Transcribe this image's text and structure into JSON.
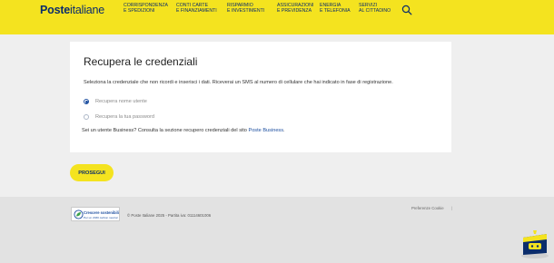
{
  "header": {
    "logo_bold": "Poste",
    "logo_regular": "italiane",
    "nav": [
      {
        "line1": "Corrispondenza",
        "line2": "e spedizioni"
      },
      {
        "line1": "Conti carte",
        "line2": "e finanziamenti"
      },
      {
        "line1": "Risparmio",
        "line2": "e investimenti"
      },
      {
        "line1": "Assicurazioni",
        "line2": "e previdenza"
      },
      {
        "line1": "Energia",
        "line2": "e telefonia"
      },
      {
        "line1": "Servizi",
        "line2": "al cittadino"
      }
    ]
  },
  "form": {
    "title": "Recupera le credenziali",
    "description": "Seleziona la credenziale che non ricordi e inserisci i dati. Riceverai un SMS al numero di cellulare che hai indicato in fase di registrazione.",
    "options": [
      {
        "label": "Recupera nome utente",
        "selected": true
      },
      {
        "label": "Recupera la tua password",
        "selected": false
      }
    ],
    "business_text": "Sei un utente Business? Consulta la sezione recupero credenziali del sito ",
    "business_link": "Poste Business",
    "business_end": "."
  },
  "button": {
    "proceed": "PROSEGUI"
  },
  "footer": {
    "badge_line1": "Crescere sostenibili",
    "badge_line2": "Per un 2030 carbon neutral",
    "copyright": "© Poste Italiane 2025 - Partita iva: 01114601006",
    "cookie": "Preferenze Cookie",
    "cookie_sep": "|"
  },
  "colors": {
    "brand_yellow": "#f4e31f",
    "brand_blue": "#0b2d6b",
    "link_blue": "#1d4fa0"
  },
  "icons": [
    "search-icon",
    "leaf-icon",
    "chatbot-icon"
  ]
}
